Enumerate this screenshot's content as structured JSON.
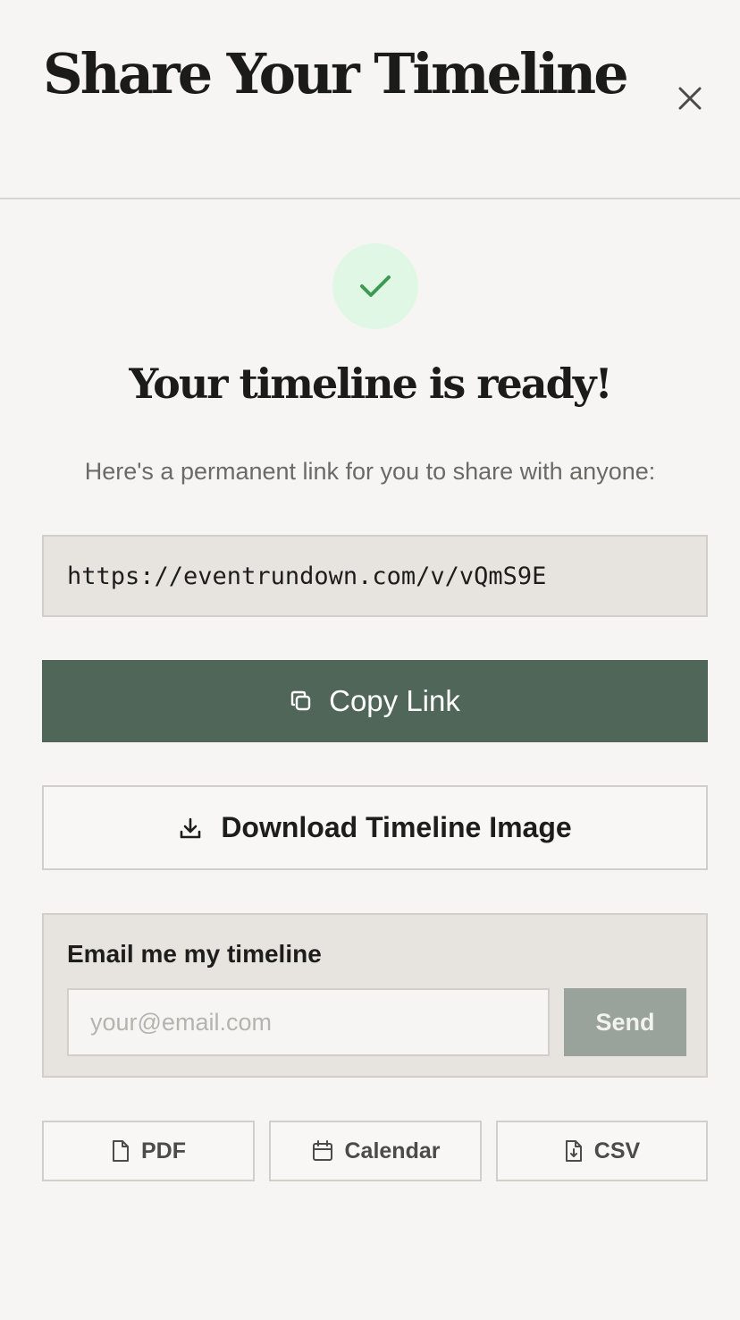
{
  "header": {
    "title": "Share Your Timeline",
    "close_icon": "close-icon"
  },
  "success": {
    "icon": "check-icon",
    "heading": "Your timeline is ready!",
    "subtext": "Here's a permanent link for you to share with anyone:"
  },
  "share_link": {
    "url": "https://eventrundown.com/v/vQmS9E"
  },
  "copy_button": {
    "icon": "copy-icon",
    "label": "Copy Link"
  },
  "download_button": {
    "icon": "download-icon",
    "label": "Download Timeline Image"
  },
  "email": {
    "label": "Email me my timeline",
    "placeholder": "your@email.com",
    "value": "",
    "send_label": "Send"
  },
  "exports": [
    {
      "icon": "file-icon",
      "label": "PDF"
    },
    {
      "icon": "calendar-icon",
      "label": "Calendar"
    },
    {
      "icon": "file-download-icon",
      "label": "CSV"
    }
  ],
  "colors": {
    "background": "#f6f5f3",
    "primary_button": "#506659",
    "success_circle": "#e1f7e5",
    "success_check": "#3e9b52",
    "disabled_button": "#9aa39b",
    "panel": "#e7e4e0"
  }
}
